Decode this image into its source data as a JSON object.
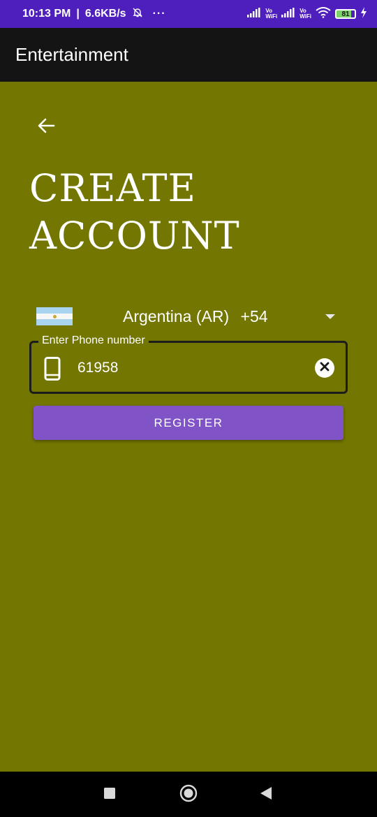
{
  "status_bar": {
    "time": "10:13 PM",
    "separator": "|",
    "network_speed": "6.6KB/s",
    "more_dots": "···",
    "vowifi_line1": "Vo",
    "vowifi_line2": "WiFi",
    "battery_level": "81"
  },
  "app_bar": {
    "title": "Entertainment"
  },
  "page": {
    "heading_line1": "CREATE",
    "heading_line2": "ACCOUNT"
  },
  "country_picker": {
    "country_name": "Argentina (AR)",
    "dial_code": "+54"
  },
  "phone_field": {
    "label": "Enter Phone number",
    "value": "61958"
  },
  "register_button": {
    "label": "REGISTER"
  },
  "icons": {
    "back": "arrow-left-icon",
    "phone": "smartphone-icon",
    "clear": "close-circle-icon",
    "dropdown": "dropdown-triangle-icon",
    "nav_recents": "square-icon",
    "nav_home": "circle-icon",
    "nav_back": "triangle-icon"
  },
  "colors": {
    "status_bar": "#4f1fbd",
    "app_bar": "#141414",
    "background": "#737600",
    "register_button": "#8053c6"
  }
}
